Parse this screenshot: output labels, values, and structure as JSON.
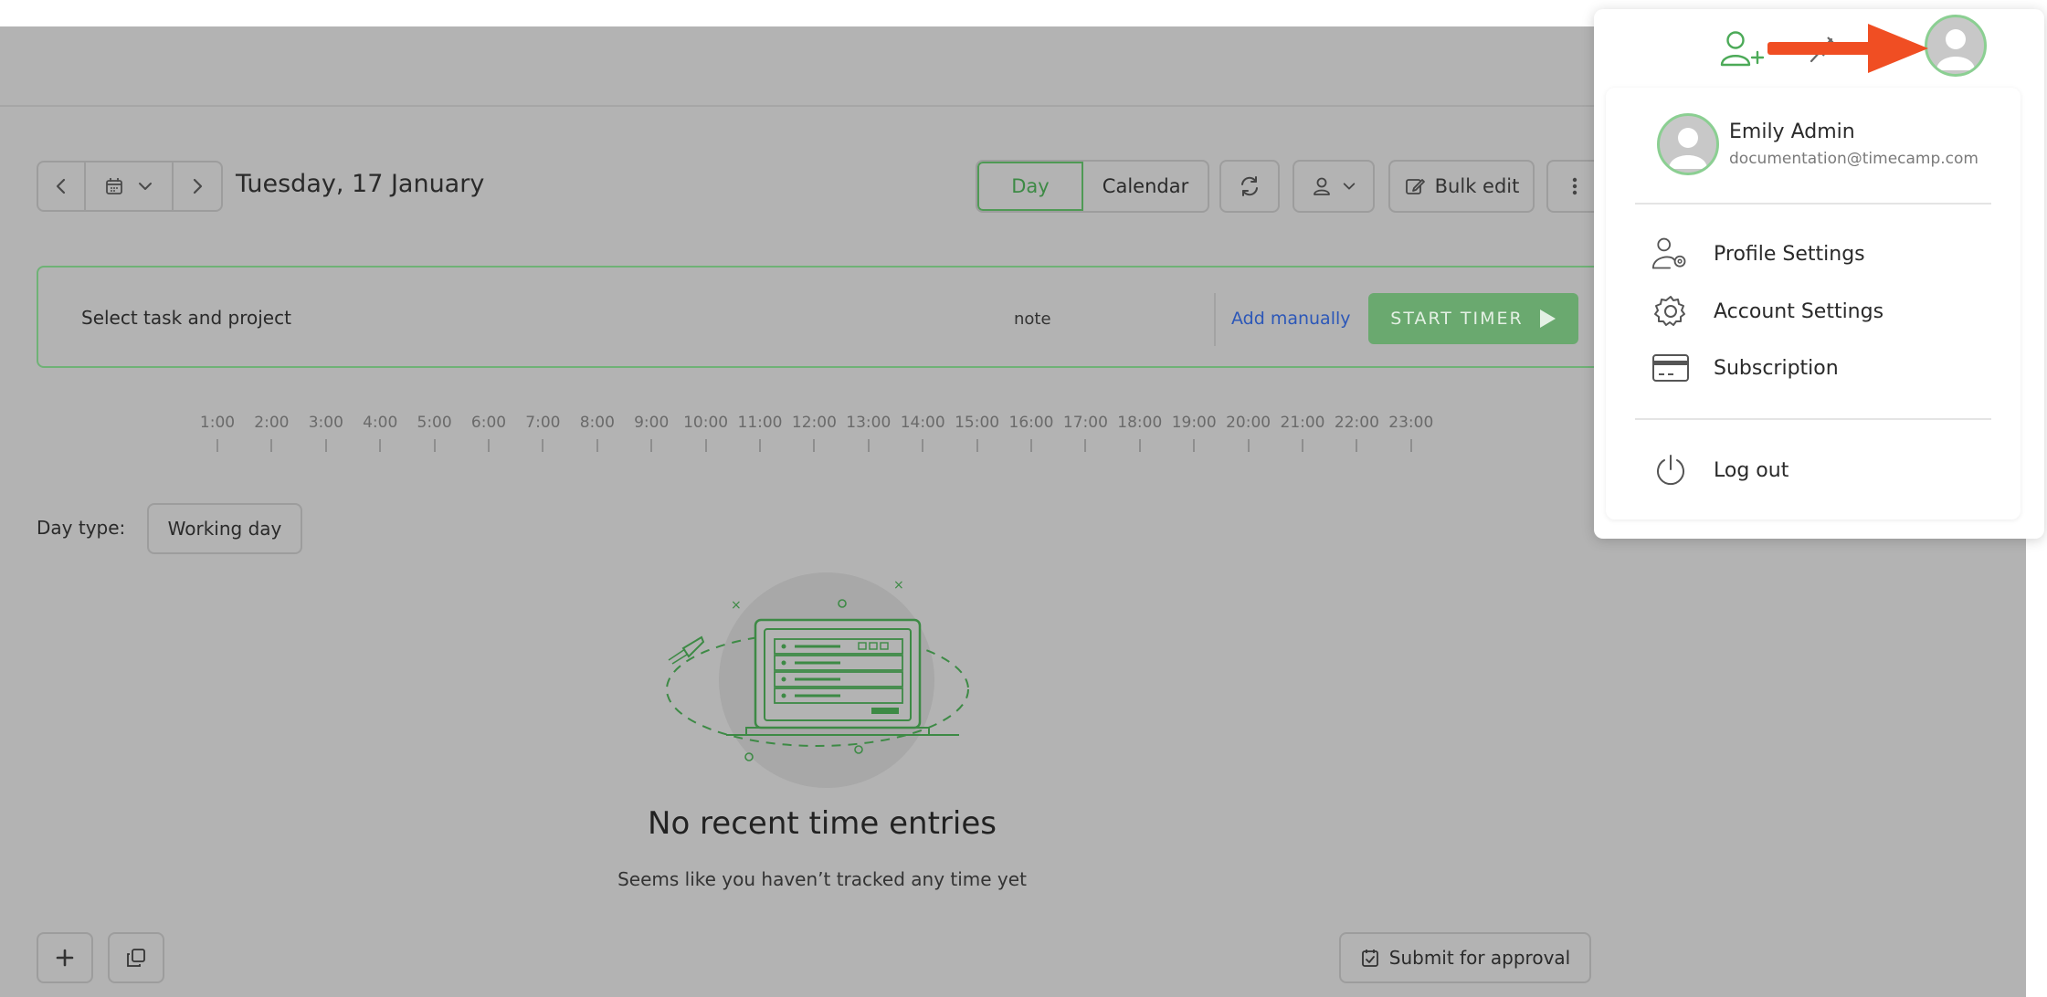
{
  "navigation": {
    "date_title": "Tuesday, 17 January"
  },
  "view": {
    "day_label": "Day",
    "calendar_label": "Calendar"
  },
  "toolbar": {
    "bulk_edit_label": "Bulk edit"
  },
  "timer": {
    "task_placeholder": "Select task and project",
    "note_placeholder": "note",
    "add_manually_label": "Add manually",
    "start_label": "START TIMER"
  },
  "timeline": {
    "hours": [
      "1:00",
      "2:00",
      "3:00",
      "4:00",
      "5:00",
      "6:00",
      "7:00",
      "8:00",
      "9:00",
      "10:00",
      "11:00",
      "12:00",
      "13:00",
      "14:00",
      "15:00",
      "16:00",
      "17:00",
      "18:00",
      "19:00",
      "20:00",
      "21:00",
      "22:00",
      "23:00"
    ]
  },
  "day_type": {
    "label": "Day type:",
    "value": "Working day"
  },
  "empty_state": {
    "title": "No recent time entries",
    "subtitle": "Seems like you haven’t tracked any time yet"
  },
  "footer": {
    "submit_label": "Submit for approval"
  },
  "user_menu": {
    "name": "Emily Admin",
    "email": "documentation@timecamp.com",
    "items": [
      {
        "label": "Profile Settings",
        "icon": "profile-settings-icon"
      },
      {
        "label": "Account Settings",
        "icon": "gear-icon"
      },
      {
        "label": "Subscription",
        "icon": "credit-card-icon"
      },
      {
        "label": "Log out",
        "icon": "power-icon"
      }
    ]
  },
  "colors": {
    "accent_green": "#6aa96f",
    "link_blue": "#2c57b8",
    "annotation_arrow": "#f04e23",
    "overlay_gray": "#b3b3b3"
  }
}
